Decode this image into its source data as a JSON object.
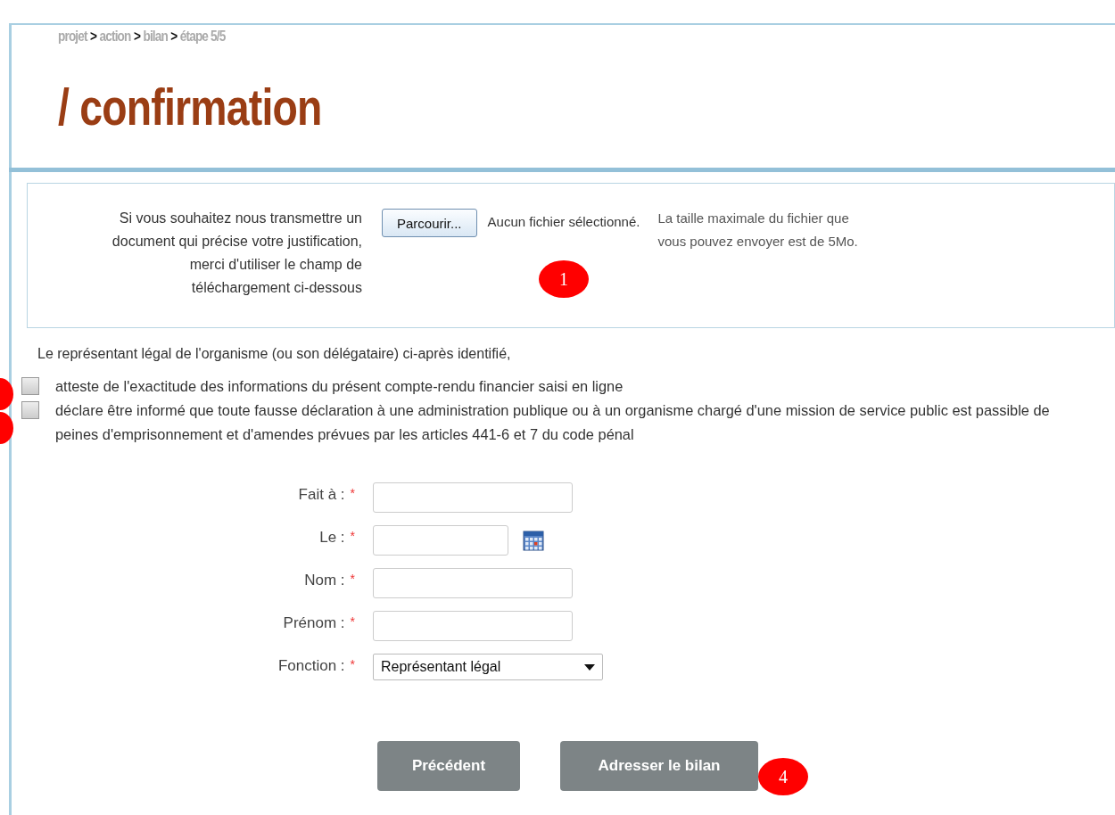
{
  "breadcrumb": [
    {
      "kind": "crumb",
      "text": "projet"
    },
    {
      "kind": "separator",
      "text": ">"
    },
    {
      "kind": "crumb",
      "text": "action"
    },
    {
      "kind": "separator",
      "text": ">"
    },
    {
      "kind": "crumb",
      "text": "bilan"
    },
    {
      "kind": "separator",
      "text": ">"
    },
    {
      "kind": "crumb",
      "text": "étape 5/5"
    }
  ],
  "title": "/ confirmation",
  "upload": {
    "instructions": "Si vous souhaitez nous transmettre un document qui précise votre justification, merci d'utiliser le champ de téléchargement ci-dessous",
    "browse_button": "Parcourir...",
    "file_status": "Aucun fichier sélectionné.",
    "size_note": "La taille maximale du fichier que vous pouvez envoyer est de 5Mo."
  },
  "declaration": {
    "intro": "Le représentant légal de l'organisme (ou son délégataire) ci-après identifié,",
    "items": [
      {
        "text": "atteste de l'exactitude des informations du présent compte-rendu financier saisi en ligne",
        "checked": false
      },
      {
        "text": "déclare être informé que toute fausse déclaration à une administration publique ou à un organisme chargé d'une mission de service public est passible de peines d'emprisonnement et d'amendes prévues par les articles 441-6 et 7 du code pénal",
        "checked": false
      }
    ]
  },
  "fields": [
    {
      "kind": "text",
      "label": "Fait à :",
      "required_mark": "*"
    },
    {
      "kind": "date",
      "label": "Le :",
      "required_mark": "*"
    },
    {
      "kind": "text",
      "label": "Nom :",
      "required_mark": "*"
    },
    {
      "kind": "text",
      "label": "Prénom :",
      "required_mark": "*"
    },
    {
      "kind": "select",
      "label": "Fonction :",
      "required_mark": "*",
      "value": "Représentant légal"
    }
  ],
  "buttons": [
    {
      "label": "Précédent"
    },
    {
      "label": "Adresser le bilan"
    }
  ],
  "markers": [
    {
      "kind": "numbered",
      "label": "1"
    },
    {
      "kind": "edge"
    },
    {
      "kind": "edge"
    },
    {
      "kind": "numbered",
      "label": "4"
    }
  ]
}
